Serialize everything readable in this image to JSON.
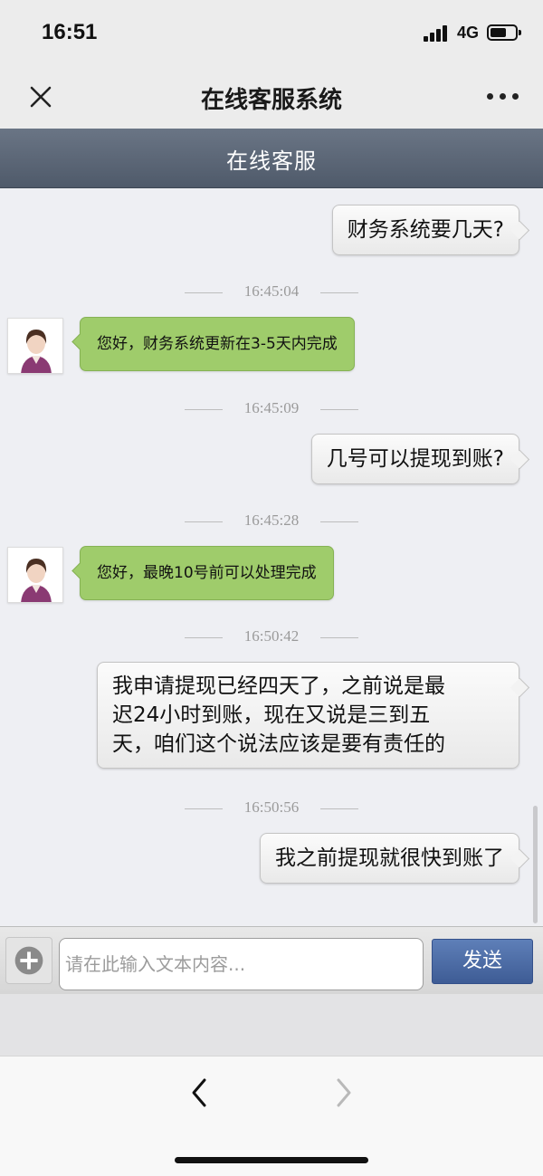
{
  "status_bar": {
    "time": "16:51",
    "network": "4G"
  },
  "nav": {
    "title": "在线客服系统",
    "close_icon": "close-icon",
    "more_icon": "more-icon"
  },
  "chat_header": {
    "title": "在线客服"
  },
  "messages": [
    {
      "type": "outgoing",
      "text": "财务系统要几天?"
    },
    {
      "type": "timestamp",
      "text": "16:45:04"
    },
    {
      "type": "incoming",
      "text": "您好，财务系统更新在3-5天内完成"
    },
    {
      "type": "timestamp",
      "text": "16:45:09"
    },
    {
      "type": "outgoing",
      "text": "几号可以提现到账?"
    },
    {
      "type": "timestamp",
      "text": "16:45:28"
    },
    {
      "type": "incoming",
      "text": "您好，最晚10号前可以处理完成"
    },
    {
      "type": "timestamp",
      "text": "16:50:42"
    },
    {
      "type": "outgoing",
      "lines": [
        "我申请提现已经四天了，之前说是最",
        "迟24小时到账，现在又说是三到五",
        "天，咱们这个说法应该是要有责任的"
      ]
    },
    {
      "type": "timestamp",
      "text": "16:50:56"
    },
    {
      "type": "outgoing",
      "text": "我之前提现就很快到账了"
    }
  ],
  "input": {
    "placeholder": "请在此输入文本内容...",
    "value": "",
    "send_label": "发送"
  },
  "toolbar": {
    "back_icon": "chevron-left-icon",
    "forward_icon": "chevron-right-icon"
  },
  "colors": {
    "incoming_bubble": "#9fcc6b",
    "outgoing_bubble": "#f3f3f3",
    "header_band": "#5c6778",
    "send_button": "#4a68a3"
  }
}
